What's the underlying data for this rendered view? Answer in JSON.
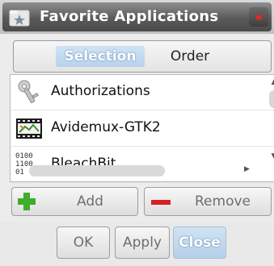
{
  "window": {
    "title": "Favorite Applications"
  },
  "tabs": [
    {
      "label": "Selection",
      "active": true
    },
    {
      "label": "Order",
      "active": false
    }
  ],
  "list": {
    "items": [
      {
        "label": "Authorizations",
        "icon": "keys-icon"
      },
      {
        "label": "Avidemux-GTK2",
        "icon": "film-icon"
      },
      {
        "label": "BleachBit",
        "icon": "binary-icon",
        "icon_text": [
          "0100",
          "1100",
          "01"
        ]
      }
    ]
  },
  "actions": {
    "add_label": "Add",
    "remove_label": "Remove"
  },
  "footer": {
    "ok_label": "OK",
    "apply_label": "Apply",
    "close_label": "Close"
  },
  "colors": {
    "accent": "#b9d4ec",
    "plus": "#3fae2a",
    "minus": "#d42121",
    "close_dot": "#e02a2a"
  }
}
